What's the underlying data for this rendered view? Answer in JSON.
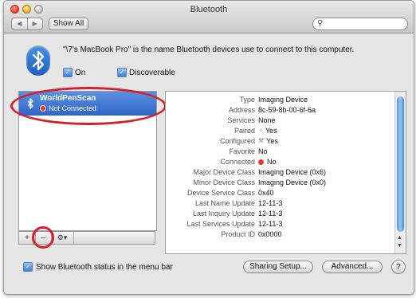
{
  "window": {
    "title": "Bluetooth"
  },
  "toolbar": {
    "back": "◀",
    "forward": "▶",
    "show_all": "Show All",
    "search_icon": "magnifier-icon",
    "search_placeholder": ""
  },
  "header": {
    "info": "\"\\7's MacBook Pro\" is the name Bluetooth devices use to connect to this computer.",
    "on_label": "On",
    "discoverable_label": "Discoverable",
    "on_checked": true,
    "discoverable_checked": true
  },
  "devices": [
    {
      "name": "WorldPenScan",
      "status": "Not Connected",
      "status_color": "#e63b2c"
    }
  ],
  "list_buttons": {
    "add": "+",
    "remove": "–",
    "action": "⚙▾"
  },
  "details": [
    {
      "label": "Type",
      "value": "Imaging Device"
    },
    {
      "label": "Address",
      "value": "8c-59-8b-00-6f-6a"
    },
    {
      "label": "Services",
      "value": "None"
    },
    {
      "label": "Paired",
      "value": "Yes",
      "icon": "paired-icon"
    },
    {
      "label": "Configured",
      "value": "Yes",
      "icon": "configured-icon"
    },
    {
      "label": "Favorite",
      "value": "No"
    },
    {
      "label": "Connected",
      "value": "No",
      "icon": "red-dot-icon"
    },
    {
      "label": "Major Device Class",
      "value": "Imaging Device (0x6)"
    },
    {
      "label": "Minor Device Class",
      "value": "Imaging Device (0x0)"
    },
    {
      "label": "Device Service Class",
      "value": "0x40"
    },
    {
      "label": "Last Name Update",
      "value": "12-11-3"
    },
    {
      "label": "Last Inquiry Update",
      "value": "12-11-3"
    },
    {
      "label": "Last Services Update",
      "value": "12-11-3"
    },
    {
      "label": "Product ID",
      "value": "0x0000"
    }
  ],
  "footer": {
    "menu_status_label": "Show Bluetooth status in the menu bar",
    "menu_status_checked": true,
    "sharing_setup": "Sharing Setup...",
    "advanced": "Advanced...",
    "help": "?"
  },
  "colors": {
    "selection": "#3a74d6",
    "annotation": "#d3212d",
    "accent": "#2e66c8"
  }
}
